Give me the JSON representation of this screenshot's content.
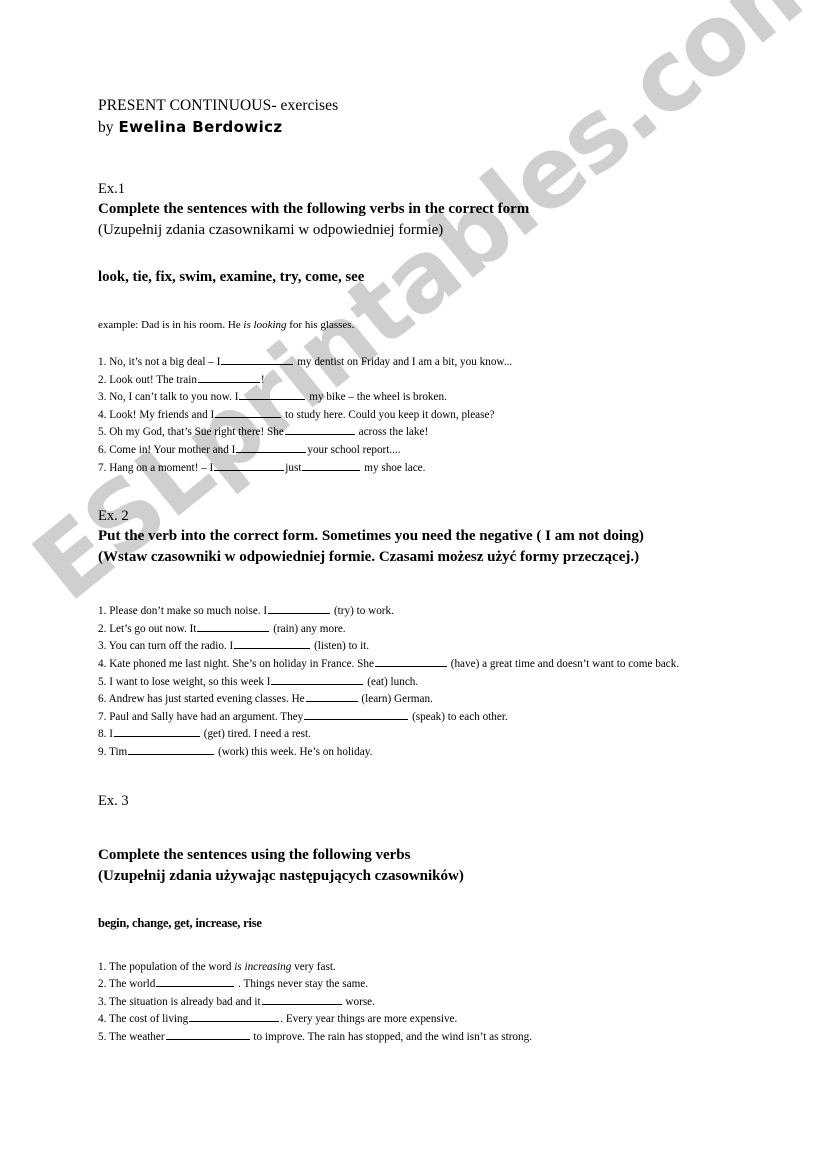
{
  "document": {
    "title": "PRESENT CONTINUOUS- exercises",
    "by_prefix": "by",
    "author": "Ewelina Berdowicz"
  },
  "watermark": {
    "text": "ESLprintables.com",
    "color": "#cfcfcf"
  },
  "exercise1": {
    "label": "Ex.1",
    "instruction_en": "Complete the sentences with the following verbs in the correct form",
    "instruction_pl": "(Uzupełnij zdania czasownikami w odpowiedniej formie)",
    "verbs": "look, tie, fix, swim, examine, try, come, see",
    "example_prefix": "example: Dad is in his room. He ",
    "example_italic": "is looking",
    "example_suffix": " for his glasses.",
    "items": [
      {
        "number": "1.",
        "before": "No, it’s not a big deal – I",
        "blank_width": 72,
        "after": "my dentist on Friday and I am a bit, you know..."
      },
      {
        "number": "2.",
        "before": "Look out! The train",
        "blank_width": 62,
        "after": "!"
      },
      {
        "number": "3.",
        "before": "No, I can’t talk to you now. I",
        "blank_width": 66,
        "after": "my bike – the wheel is broken."
      },
      {
        "number": "4.",
        "before": "Look! My friends and I",
        "blank_width": 66,
        "after": "to study here. Could you keep it down, please?"
      },
      {
        "number": "5.",
        "before": "Oh my God, that’s Sue right there! She",
        "blank_width": 70,
        "after": "across the lake!"
      },
      {
        "number": "6.",
        "before": "Come in!  Your mother and I",
        "blank_width": 70,
        "after": "your school report...."
      },
      {
        "number": "7.",
        "before": "Hang on a moment! – I",
        "blank_width": 70,
        "middle": "just",
        "blank2_width": 58,
        "after": "my shoe lace."
      }
    ]
  },
  "exercise2": {
    "label": "Ex. 2",
    "instruction_en": " Put the verb into the correct form. Sometimes you need the negative ( I am not doing)",
    "instruction_pl": "(Wstaw czasowniki w odpowiedniej formie. Czasami możesz użyć formy przeczącej.)",
    "items": [
      {
        "number": "1.",
        "before": " Please don’t make so much noise. I",
        "blank_width": 62,
        "after": "(try) to work."
      },
      {
        "number": "2.",
        "before": "Let’s go out now. It",
        "blank_width": 72,
        "after": "(rain) any more."
      },
      {
        "number": "3.",
        "before": "You can turn off the radio. I",
        "blank_width": 76,
        "after": "(listen) to it."
      },
      {
        "number": "4.",
        "before": "Kate phoned me last night. She’s on holiday in France. She",
        "blank_width": 72,
        "after": "(have) a great time and doesn’t want to come back."
      },
      {
        "number": "5.",
        "before": "I want to lose weight, so this week I",
        "blank_width": 92,
        "after": "(eat) lunch."
      },
      {
        "number": "6.",
        "before": "Andrew has just started evening classes. He",
        "blank_width": 52,
        "after": "(learn) German."
      },
      {
        "number": "7.",
        "before": "Paul and Sally have had an argument. They",
        "blank_width": 104,
        "after": "(speak) to each other."
      },
      {
        "number": "8.",
        "before": "I",
        "blank_width": 86,
        "after": "(get) tired. I need a rest."
      },
      {
        "number": "9.",
        "before": "Tim",
        "blank_width": 86,
        "after": "(work) this week. He’s on holiday."
      }
    ]
  },
  "exercise3": {
    "label": "Ex. 3",
    "instruction_en": "Complete the sentences using the following verbs",
    "instruction_pl": "(Uzupełnij zdania używając następujących czasowników)",
    "verbs": "begin, change, get, increase, rise",
    "items": [
      {
        "number": "1.",
        "before": "The population of the word ",
        "italic": "is increasing",
        "after_italic": " very fast.",
        "blank_width": 0,
        "after": ""
      },
      {
        "number": "2.",
        "before": "The world",
        "blank_width": 78,
        "after": ". Things never stay the same."
      },
      {
        "number": "3.",
        "before": "The situation is already bad and it",
        "blank_width": 80,
        "after": "worse."
      },
      {
        "number": "4.",
        "before": "The cost of living",
        "blank_width": 90,
        "after": ". Every year things are more expensive."
      },
      {
        "number": "5.",
        "before": "The weather",
        "blank_width": 84,
        "after": "to improve. The rain has stopped, and the wind isn’t as strong."
      }
    ]
  }
}
